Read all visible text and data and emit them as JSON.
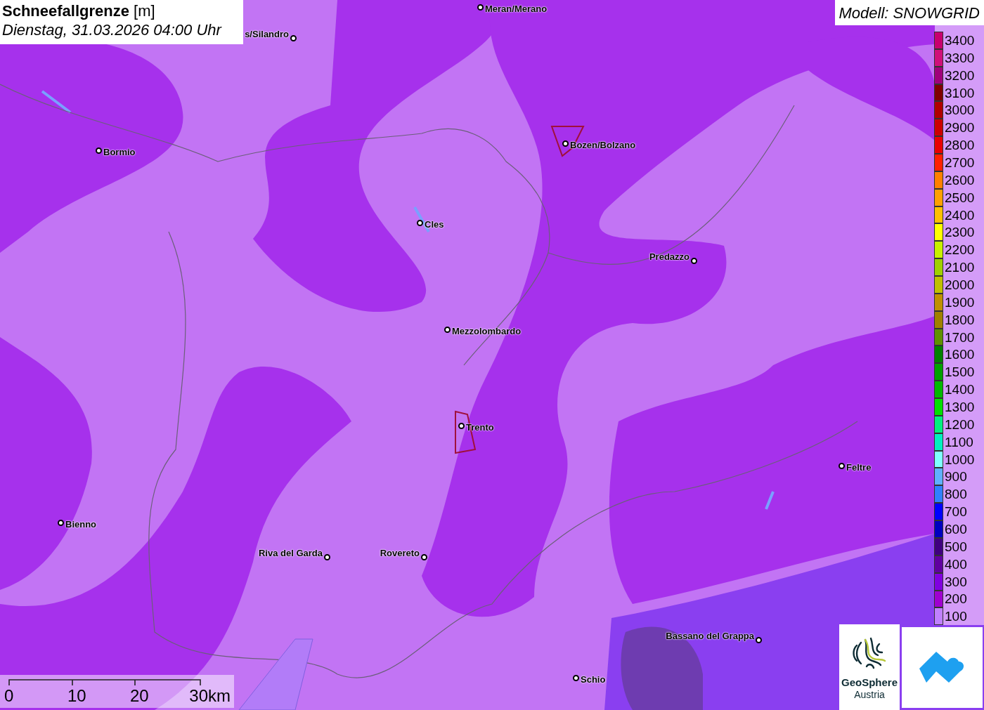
{
  "header": {
    "title": "**Schneefallgrenze** [m]",
    "datetime": "Dienstag, 31.03.2026 04:00 Uhr"
  },
  "model": "Modell: SNOWGRID",
  "legend": [
    {
      "label": "3400",
      "color": "#c8006e"
    },
    {
      "label": "3300",
      "color": "#d0107a"
    },
    {
      "label": "3200",
      "color": "#a0007a"
    },
    {
      "label": "3100",
      "color": "#800000"
    },
    {
      "label": "3000",
      "color": "#b00000"
    },
    {
      "label": "2900",
      "color": "#cc0000"
    },
    {
      "label": "2800",
      "color": "#e80000"
    },
    {
      "label": "2700",
      "color": "#ff2000"
    },
    {
      "label": "2600",
      "color": "#ff8000"
    },
    {
      "label": "2500",
      "color": "#ffa000"
    },
    {
      "label": "2400",
      "color": "#ffc000"
    },
    {
      "label": "2300",
      "color": "#ffff00"
    },
    {
      "label": "2200",
      "color": "#c8f000"
    },
    {
      "label": "2100",
      "color": "#a0d000"
    },
    {
      "label": "2000",
      "color": "#c0c000"
    },
    {
      "label": "1900",
      "color": "#c09000"
    },
    {
      "label": "1800",
      "color": "#a08000"
    },
    {
      "label": "1700",
      "color": "#609000"
    },
    {
      "label": "1600",
      "color": "#008000"
    },
    {
      "label": "1500",
      "color": "#00a000"
    },
    {
      "label": "1400",
      "color": "#00b800"
    },
    {
      "label": "1300",
      "color": "#00e000"
    },
    {
      "label": "1200",
      "color": "#00f080"
    },
    {
      "label": "1100",
      "color": "#00f0c0"
    },
    {
      "label": "1000",
      "color": "#80ffff"
    },
    {
      "label": "900",
      "color": "#60b0ff"
    },
    {
      "label": "800",
      "color": "#3080ff"
    },
    {
      "label": "700",
      "color": "#0000ff"
    },
    {
      "label": "600",
      "color": "#0000c0"
    },
    {
      "label": "500",
      "color": "#400080"
    },
    {
      "label": "400",
      "color": "#6000a0"
    },
    {
      "label": "300",
      "color": "#8000e0"
    },
    {
      "label": "200",
      "color": "#a000d0"
    },
    {
      "label": "100",
      "color": "#c080ff"
    }
  ],
  "cities": [
    {
      "name": "Meran/Merano"
    },
    {
      "name": "s/Silandro"
    },
    {
      "name": "Bormio"
    },
    {
      "name": "Bozen/Bolzano"
    },
    {
      "name": "Cles"
    },
    {
      "name": "Predazzo"
    },
    {
      "name": "Mezzolombardo"
    },
    {
      "name": "Trento"
    },
    {
      "name": "Feltre"
    },
    {
      "name": "Bienno"
    },
    {
      "name": "Riva del Garda"
    },
    {
      "name": "Rovereto"
    },
    {
      "name": "Bassano del Grappa"
    },
    {
      "name": "Schio"
    }
  ],
  "scale_bar": [
    "0",
    "10",
    "20",
    "30km"
  ],
  "logos": [
    {
      "kind": "geosphere",
      "lines": [
        "GeoSphere",
        "Austria"
      ]
    },
    {
      "kind": "cloud"
    }
  ]
}
